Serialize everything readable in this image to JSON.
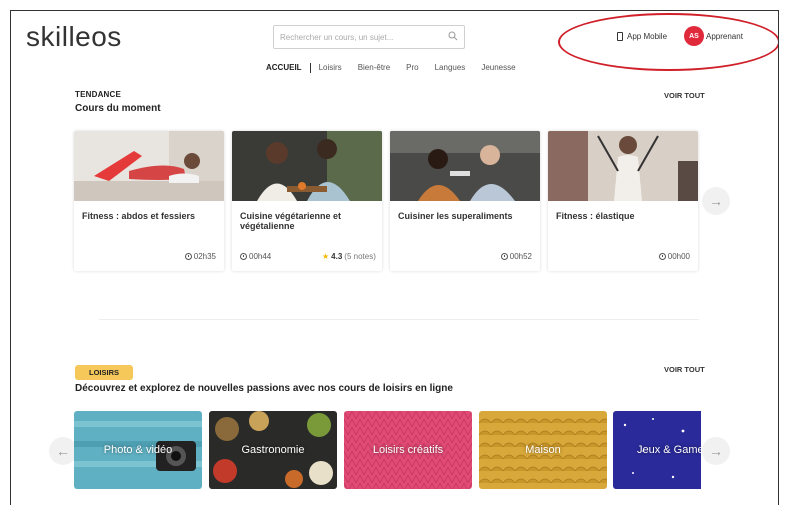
{
  "header": {
    "logo": "skilleos",
    "search_placeholder": "Rechercher un cours, un sujet...",
    "app_mobile_label": "App Mobile",
    "avatar_initials": "AS",
    "user_role": "Apprenant"
  },
  "nav": {
    "items": [
      "ACCUEIL",
      "Loisirs",
      "Bien-être",
      "Pro",
      "Langues",
      "Jeunesse"
    ]
  },
  "trending": {
    "kicker": "TENDANCE",
    "title": "Cours du moment",
    "voir_tout": "VOIR TOUT",
    "cards": [
      {
        "title": "Fitness : abdos et fessiers",
        "duration": "02h35"
      },
      {
        "title": "Cuisine végétarienne et végétalienne",
        "duration": "00h44",
        "rating": "4.3",
        "rating_count": "(5 notes)"
      },
      {
        "title": "Cuisiner les superaliments",
        "duration": "00h52"
      },
      {
        "title": "Fitness : élastique",
        "duration": "00h00"
      }
    ]
  },
  "leisure": {
    "badge": "LOISIRS",
    "title": "Découvrez et explorez de nouvelles passions avec nos cours de loisirs en ligne",
    "voir_tout": "VOIR TOUT",
    "tiles": [
      "Photo & vidéo",
      "Gastronomie",
      "Loisirs créatifs",
      "Maison",
      "Jeux & Games"
    ]
  },
  "colors": {
    "avatar": "#e02a3c",
    "badge": "#f6c85a",
    "annotation": "#d0202a"
  }
}
